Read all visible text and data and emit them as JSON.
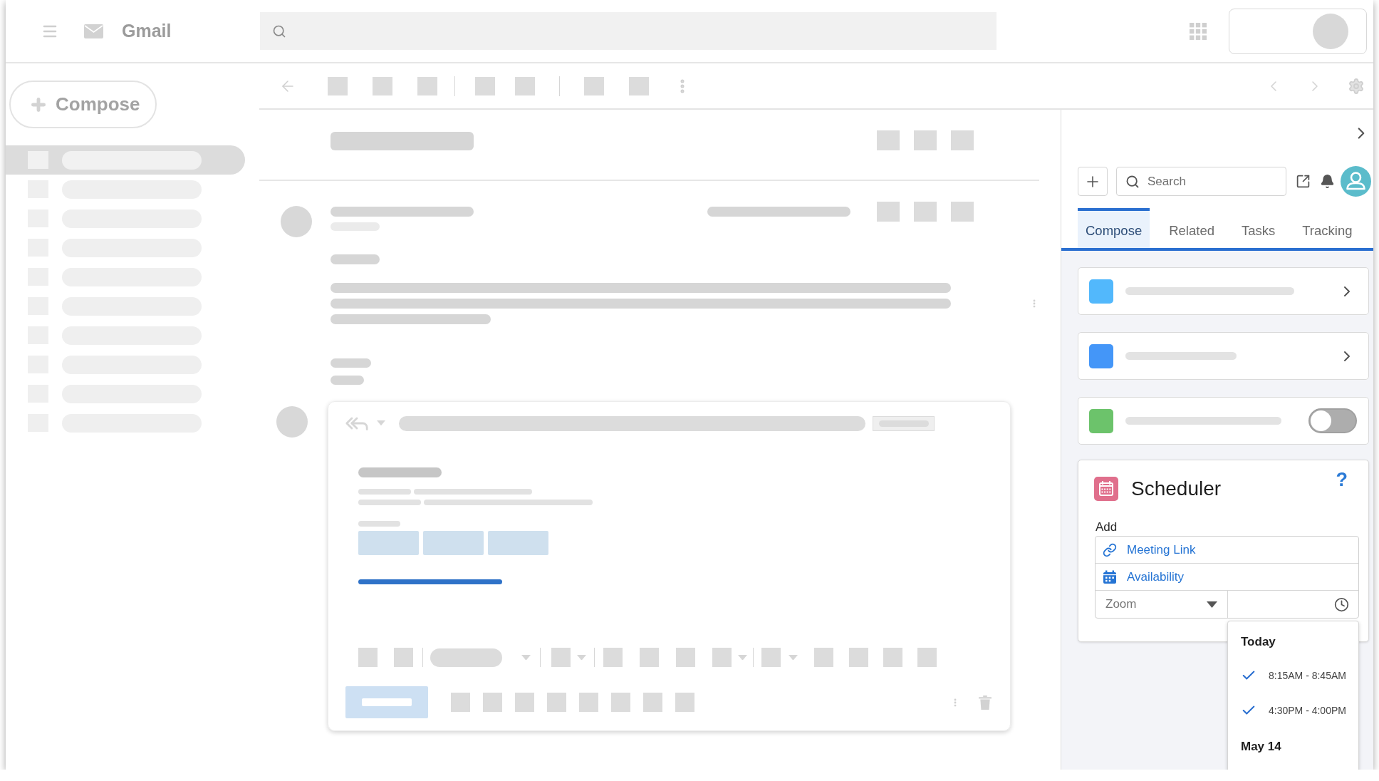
{
  "app": {
    "name": "Gmail"
  },
  "sidebar": {
    "compose_label": "Compose",
    "items": [
      {
        "selected": true
      },
      {
        "selected": false
      },
      {
        "selected": false
      },
      {
        "selected": false
      },
      {
        "selected": false
      },
      {
        "selected": false
      },
      {
        "selected": false
      },
      {
        "selected": false
      },
      {
        "selected": false
      },
      {
        "selected": false
      }
    ]
  },
  "side_panel": {
    "search": {
      "placeholder": "Search"
    },
    "tabs": [
      {
        "label": "Compose",
        "selected": true
      },
      {
        "label": "Related",
        "selected": false
      },
      {
        "label": "Tasks",
        "selected": false
      },
      {
        "label": "Tracking",
        "selected": false
      }
    ],
    "cards": [
      {
        "kind": "link",
        "color": "#52b8fc"
      },
      {
        "kind": "link",
        "color": "#4496f8"
      },
      {
        "kind": "toggle",
        "color": "#6cc36b",
        "on": false
      }
    ],
    "scheduler": {
      "title": "Scheduler",
      "help": "?",
      "add_label": "Add",
      "options": [
        {
          "kind": "link",
          "label": "Meeting Link"
        },
        {
          "kind": "calendar",
          "label": "Availability"
        }
      ],
      "conference": {
        "value": "Zoom"
      },
      "time_menu": {
        "groups": [
          {
            "heading": "Today",
            "slots": [
              {
                "time": "8:15AM - 8:45AM",
                "checked": true
              },
              {
                "time": "4:30PM - 4:00PM",
                "checked": true
              }
            ]
          },
          {
            "heading": "May 14"
          }
        ]
      }
    }
  }
}
